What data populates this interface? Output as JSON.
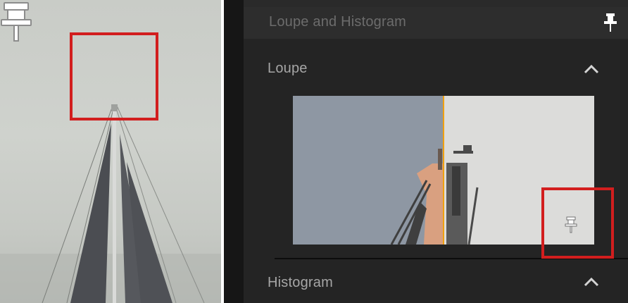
{
  "panel": {
    "header_title": "Loupe and Histogram",
    "sections": [
      {
        "title": "Loupe",
        "expanded": true
      },
      {
        "title": "Histogram",
        "expanded": true
      }
    ]
  },
  "icons": {
    "photo_pin": "pin-icon",
    "header_pin": "pin-icon",
    "loupe_pin": "pin-icon",
    "collapse": "chevron-up-icon"
  },
  "colors": {
    "highlight": "#d21e1e",
    "loupe_split_line": "#f0a010",
    "panel_bg": "#242424"
  }
}
